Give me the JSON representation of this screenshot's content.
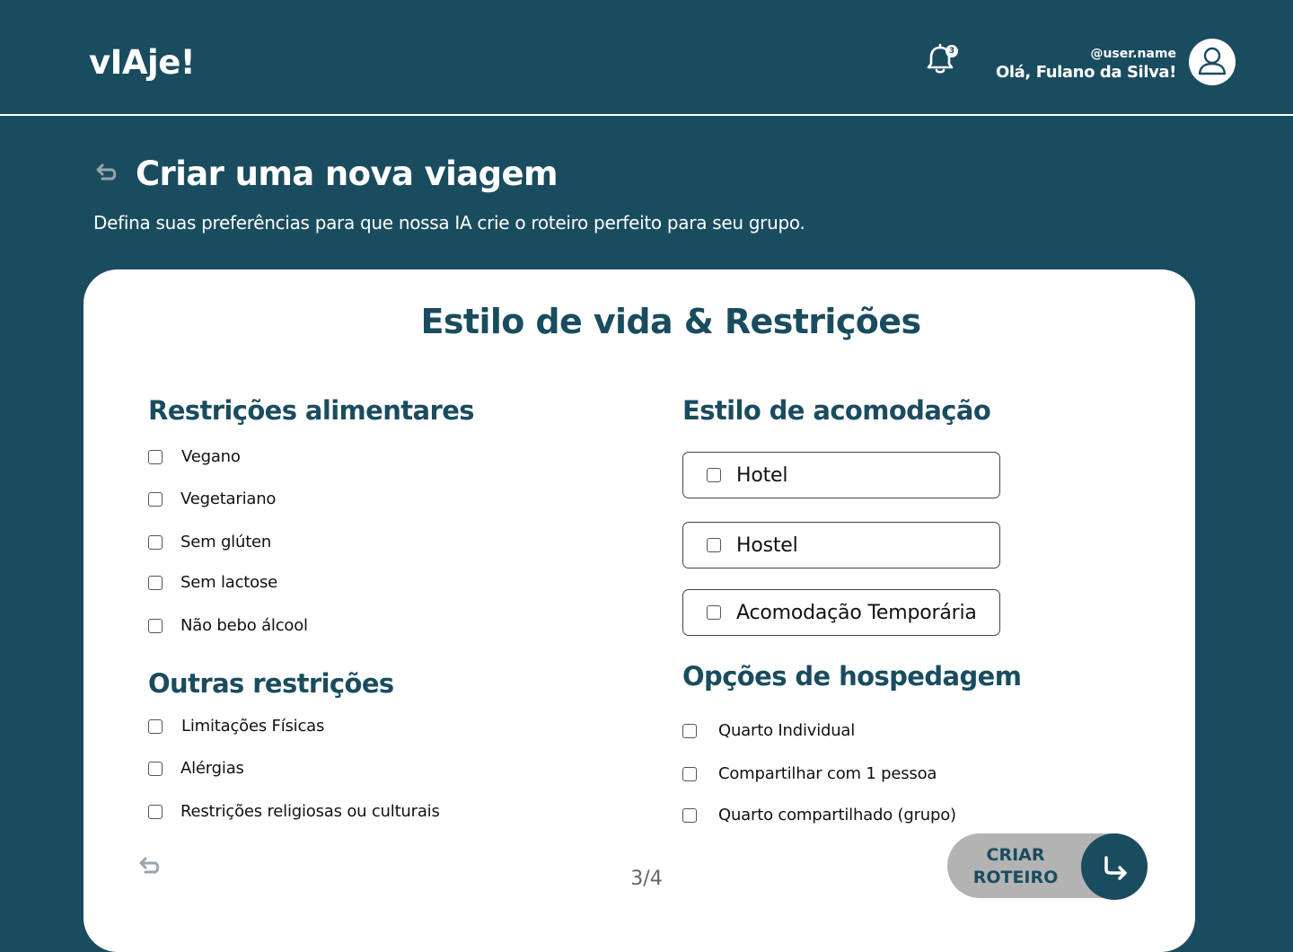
{
  "header": {
    "logo": "vIAje!",
    "notifications_count": "3",
    "user_handle": "@user.name",
    "user_greeting": "Olá, Fulano da Silva!"
  },
  "page": {
    "title": "Criar uma nova viagem",
    "subtitle": "Defina suas preferências para que nossa IA crie o roteiro perfeito para seu grupo."
  },
  "card": {
    "title": "Estilo de vida & Restrições",
    "dietary": {
      "heading": "Restrições alimentares",
      "items": [
        "Vegano",
        "Vegetariano",
        "Sem glúten",
        "Sem lactose",
        "Não bebo álcool"
      ]
    },
    "other": {
      "heading": "Outras restrições",
      "items": [
        "Limitações Físicas",
        "Alérgias",
        "Restrições religiosas ou culturais"
      ]
    },
    "accommodation": {
      "heading": "Estilo de acomodação",
      "items": [
        "Hotel",
        "Hostel",
        "Acomodação Temporária"
      ]
    },
    "lodging": {
      "heading": "Opções de hospedagem",
      "items": [
        "Quarto Individual",
        "Compartilhar com 1 pessoa",
        "Quarto compartilhado (grupo)"
      ]
    }
  },
  "footer": {
    "pager": "3/4",
    "cta_line1": "CRIAR",
    "cta_line2": "ROTEIRO"
  },
  "icons": {
    "bell": "bell-icon",
    "avatar": "user-icon",
    "back": "undo-arrow-icon",
    "cta": "redo-arrow-icon"
  },
  "colors": {
    "brand": "#1a4c5f",
    "cta_bg": "#b3b3b3",
    "card_bg": "#ffffff"
  }
}
